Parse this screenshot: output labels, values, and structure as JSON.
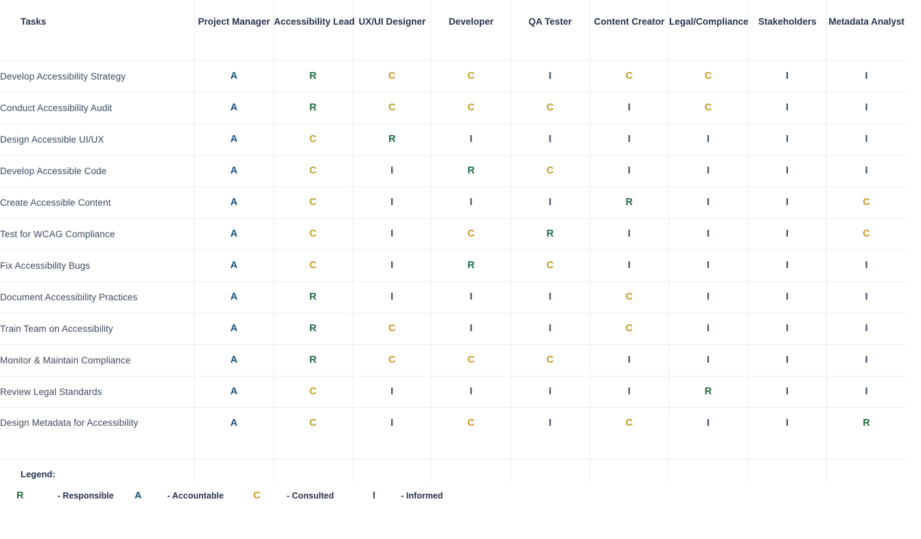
{
  "colors": {
    "responsible": "#1e6b3c",
    "accountable": "#16537e",
    "consulted": "#c8971e",
    "informed": "#3b4a60",
    "header_text": "#26334d",
    "grid_line": "#eceef1",
    "task_text": "#3b4a60",
    "background": "#ffffff"
  },
  "table": {
    "task_header": "Tasks",
    "roles": [
      "Project Manager",
      "Accessibility Lead",
      "UX/UI Designer",
      "Developer",
      "QA Tester",
      "Content Creator",
      "Legal/Compliance",
      "Stakeholders",
      "Metadata Analyst"
    ],
    "rows": [
      {
        "task": "Develop Accessibility Strategy",
        "values": [
          "A",
          "R",
          "C",
          "C",
          "I",
          "C",
          "C",
          "I",
          "I"
        ]
      },
      {
        "task": "Conduct Accessibility Audit",
        "values": [
          "A",
          "R",
          "C",
          "C",
          "C",
          "I",
          "C",
          "I",
          "I"
        ]
      },
      {
        "task": "Design Accessible UI/UX",
        "values": [
          "A",
          "C",
          "R",
          "I",
          "I",
          "I",
          "I",
          "I",
          "I"
        ]
      },
      {
        "task": "Develop Accessible Code",
        "values": [
          "A",
          "C",
          "I",
          "R",
          "C",
          "I",
          "I",
          "I",
          "I"
        ]
      },
      {
        "task": "Create Accessible Content",
        "values": [
          "A",
          "C",
          "I",
          "I",
          "I",
          "R",
          "I",
          "I",
          "C"
        ]
      },
      {
        "task": "Test for WCAG Compliance",
        "values": [
          "A",
          "C",
          "I",
          "C",
          "R",
          "I",
          "I",
          "I",
          "C"
        ]
      },
      {
        "task": "Fix Accessibility Bugs",
        "values": [
          "A",
          "C",
          "I",
          "R",
          "C",
          "I",
          "I",
          "I",
          "I"
        ]
      },
      {
        "task": "Document Accessibility Practices",
        "values": [
          "A",
          "R",
          "I",
          "I",
          "I",
          "C",
          "I",
          "I",
          "I"
        ]
      },
      {
        "task": "Train Team on Accessibility",
        "values": [
          "A",
          "R",
          "C",
          "I",
          "I",
          "C",
          "I",
          "I",
          "I"
        ]
      },
      {
        "task": "Monitor & Maintain Compliance",
        "values": [
          "A",
          "R",
          "C",
          "C",
          "C",
          "I",
          "I",
          "I",
          "I"
        ]
      },
      {
        "task": "Review Legal Standards",
        "values": [
          "A",
          "C",
          "I",
          "I",
          "I",
          "I",
          "R",
          "I",
          "I"
        ]
      },
      {
        "task": "Design Metadata for Accessibility",
        "values": [
          "A",
          "C",
          "I",
          "C",
          "I",
          "C",
          "I",
          "I",
          "R"
        ]
      }
    ]
  },
  "legend": {
    "title": "Legend:",
    "items": [
      {
        "key": "R",
        "label": "- Responsible"
      },
      {
        "key": "A",
        "label": "- Accountable"
      },
      {
        "key": "C",
        "label": "- Consulted"
      },
      {
        "key": "I",
        "label": "- Informed"
      }
    ]
  }
}
